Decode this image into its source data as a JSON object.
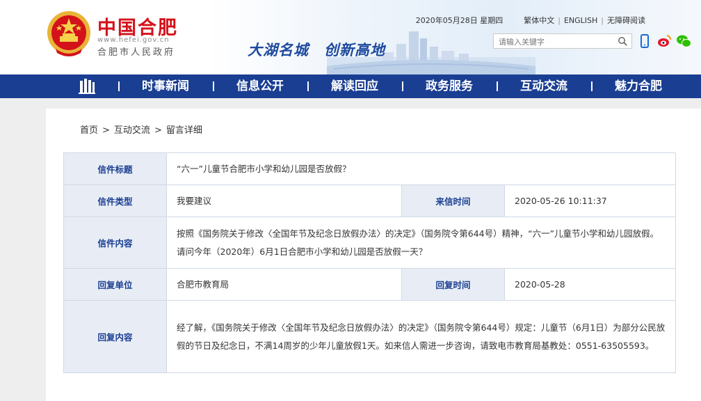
{
  "header": {
    "site_title": "中国合肥",
    "site_url": "www.hefei.gov.cn",
    "site_subtitle": "合肥市人民政府",
    "slogan": "大湖名城　创新高地",
    "date": "2020年05月28日 星期四",
    "links": [
      "繁体中文",
      "ENGLISH",
      "无障碍阅读"
    ],
    "search_placeholder": "请输入关键字"
  },
  "nav": {
    "items": [
      "时事新闻",
      "信息公开",
      "解读回应",
      "政务服务",
      "互动交流",
      "魅力合肥"
    ]
  },
  "breadcrumb": [
    "首页",
    "互动交流",
    "留言详细"
  ],
  "detail": {
    "title_label": "信件标题",
    "title_value": "“六一”儿童节合肥市小学和幼儿园是否放假？",
    "type_label": "信件类型",
    "type_value": "我要建议",
    "date_label": "来信时间",
    "date_value": "2020-05-26 10:11:37",
    "content_label": "信件内容",
    "content_value": "按照《国务院关于修改〈全国年节及纪念日放假办法〉的决定》（国务院令第644号）精神，“六一”儿童节小学和幼儿园放假。请问今年（2020年）6月1日合肥市小学和幼儿园是否放假一天？",
    "reply_unit_label": "回复单位",
    "reply_unit_value": "合肥市教育局",
    "reply_time_label": "回复时间",
    "reply_time_value": "2020-05-28",
    "reply_content_label": "回复内容",
    "reply_content_value": "经了解，《国务院关于修改〈全国年节及纪念日放假办法〉的决定》（国务院令第644号）规定：儿童节（6月1日）为部分公民放假的节日及纪念日，不满14周岁的少年儿童放假1天。如来信人需进一步咨询，请致电市教育局基教处：0551-63505593。"
  },
  "colors": {
    "brand_red": "#d4121a",
    "nav_blue": "#1a3e92",
    "label_bg": "#e8edf5"
  }
}
